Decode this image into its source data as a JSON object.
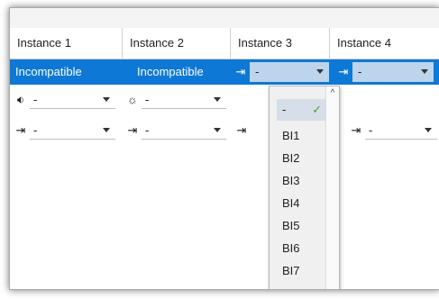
{
  "columns": [
    {
      "label": "Instance 1"
    },
    {
      "label": "Instance 2"
    },
    {
      "label": "Instance 3"
    },
    {
      "label": "Instance 4"
    }
  ],
  "row1": {
    "col1": "Incompatible",
    "col2": "Incompatible",
    "col3_value": "-",
    "col4_value": "-"
  },
  "row2": {
    "col1_icon": "sound-icon",
    "col1_value": "-",
    "col2_icon": "sun-icon",
    "col2_value": "-"
  },
  "row3": {
    "col1_icon": "input-icon",
    "col1_value": "-",
    "col2_icon": "input-icon",
    "col2_value": "-",
    "col3_icon": "input-icon",
    "col4_icon": "input-icon",
    "col4_value": "-"
  },
  "dropdown": {
    "selected": "-",
    "options": [
      "-",
      "BI1",
      "BI2",
      "BI3",
      "BI4",
      "BI5",
      "BI6",
      "BI7"
    ]
  },
  "colors": {
    "selection": "#0e78d6",
    "combo_selected_bg": "#bcd4ec",
    "check": "#5aa02c"
  }
}
